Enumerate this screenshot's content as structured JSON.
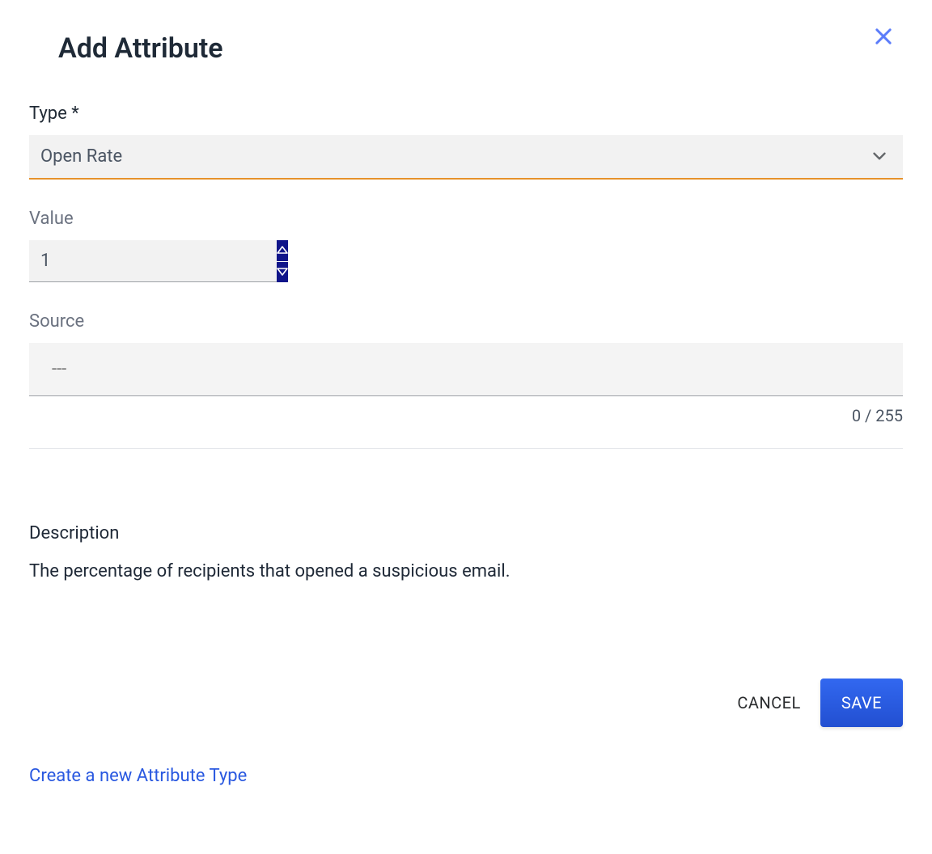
{
  "dialog": {
    "title": "Add Attribute"
  },
  "fields": {
    "type": {
      "label": "Type *",
      "value": "Open Rate"
    },
    "value": {
      "label": "Value",
      "value": "1"
    },
    "source": {
      "label": "Source",
      "placeholder": "---",
      "counter": "0 / 255"
    }
  },
  "description": {
    "label": "Description",
    "text": "The percentage of recipients that opened a suspicious email."
  },
  "actions": {
    "cancel": "CANCEL",
    "save": "SAVE"
  },
  "link": {
    "create_type": "Create a new Attribute Type"
  }
}
